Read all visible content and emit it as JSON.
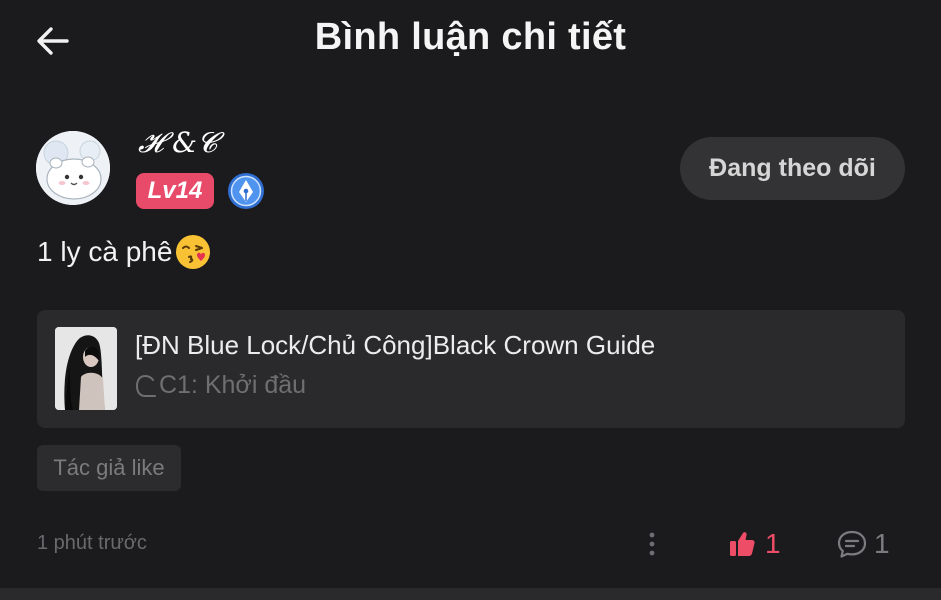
{
  "header": {
    "title": "Bình luận chi tiết",
    "back_icon": "arrow-left-icon"
  },
  "comment": {
    "user": {
      "name": "𝓗 &𝓒",
      "level": "Lv14",
      "badge_icon": "fountain-pen-badge-icon"
    },
    "follow_label": "Đang theo dõi",
    "text": "1 ly cà phê",
    "emoji": "kissing-face-emoji",
    "book": {
      "title": "[ĐN Blue Lock/Chủ Công]Black Crown Guide",
      "chapter": "C1: Khởi đầu"
    },
    "author_tag": "Tác giả like",
    "timestamp": "1 phút trước",
    "likes": "1",
    "replies": "1"
  },
  "colors": {
    "background": "#1b1b1d",
    "accent_like": "#ee4d68",
    "level_badge": "#e84a6a",
    "card": "#2a2a2c"
  }
}
